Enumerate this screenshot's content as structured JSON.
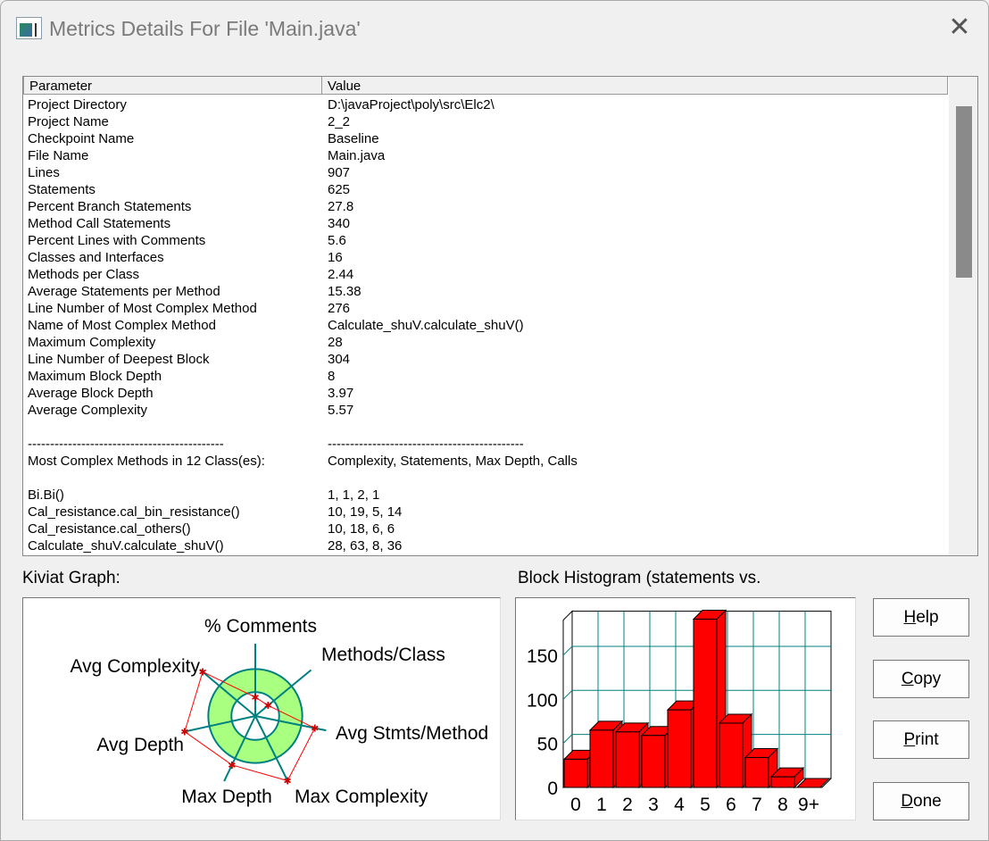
{
  "window": {
    "title": "Metrics Details For File 'Main.java'",
    "close_icon": "close-icon",
    "app_icon": "metrics-window-icon"
  },
  "table": {
    "headers": [
      "Parameter",
      "Value"
    ],
    "rows": [
      [
        "Project Directory",
        "D:\\javaProject\\poly\\src\\Elc2\\"
      ],
      [
        "Project Name",
        "2_2"
      ],
      [
        "Checkpoint Name",
        "Baseline"
      ],
      [
        "File Name",
        "Main.java"
      ],
      [
        "Lines",
        "907"
      ],
      [
        "Statements",
        "625"
      ],
      [
        "Percent Branch Statements",
        "27.8"
      ],
      [
        "Method Call Statements",
        "340"
      ],
      [
        "Percent Lines with Comments",
        "5.6"
      ],
      [
        "Classes and Interfaces",
        "16"
      ],
      [
        "Methods per Class",
        "2.44"
      ],
      [
        "Average Statements per Method",
        "15.38"
      ],
      [
        "Line Number of Most Complex Method",
        "276"
      ],
      [
        "Name of Most Complex Method",
        "Calculate_shuV.calculate_shuV()"
      ],
      [
        "Maximum Complexity",
        "28"
      ],
      [
        "Line Number of Deepest Block",
        "304"
      ],
      [
        "Maximum Block Depth",
        "8"
      ],
      [
        "Average Block Depth",
        "3.97"
      ],
      [
        "Average Complexity",
        "5.57"
      ],
      [
        "",
        ""
      ],
      [
        "--------------------------------------------",
        "--------------------------------------------"
      ],
      [
        "Most Complex Methods in 12 Class(es):",
        "Complexity, Statements, Max Depth, Calls"
      ],
      [
        "",
        ""
      ],
      [
        "Bi.Bi()",
        "1, 1, 2, 1"
      ],
      [
        "Cal_resistance.cal_bin_resistance()",
        "10, 19, 5, 14"
      ],
      [
        "Cal_resistance.cal_others()",
        "10, 18, 6, 6"
      ],
      [
        "Calculate_shuV.calculate_shuV()",
        "28, 63, 8, 36"
      ]
    ]
  },
  "kiviat": {
    "label": "Kiviat Graph:",
    "axes": [
      "% Comments",
      "Methods/Class",
      "Avg Stmts/Method",
      "Max Complexity",
      "Max Depth",
      "Avg Depth",
      "Avg Complexity"
    ],
    "values": [
      0.26,
      0.23,
      0.84,
      1.0,
      0.75,
      1.0,
      0.95
    ],
    "normal_range": [
      0.33,
      0.65
    ],
    "colors": {
      "band": "#a8ff80",
      "axis": "#008080",
      "polygon": "#ff0000"
    }
  },
  "histogram": {
    "label": "Block Histogram (statements vs.",
    "chart_data": {
      "type": "bar",
      "categories": [
        "0",
        "1",
        "2",
        "3",
        "4",
        "5",
        "6",
        "7",
        "8",
        "9+"
      ],
      "values": [
        32,
        65,
        63,
        59,
        88,
        191,
        73,
        34,
        12,
        0
      ],
      "yticks": [
        0,
        50,
        100,
        150
      ],
      "ylim": [
        0,
        200
      ],
      "grid": true,
      "colors": {
        "bar": "#ff0000",
        "grid": "#008080"
      }
    }
  },
  "buttons": [
    {
      "pre": "",
      "u": "H",
      "post": "elp"
    },
    {
      "pre": "",
      "u": "C",
      "post": "opy"
    },
    {
      "pre": "",
      "u": "P",
      "post": "rint"
    },
    {
      "pre": "",
      "u": "D",
      "post": "one"
    }
  ]
}
